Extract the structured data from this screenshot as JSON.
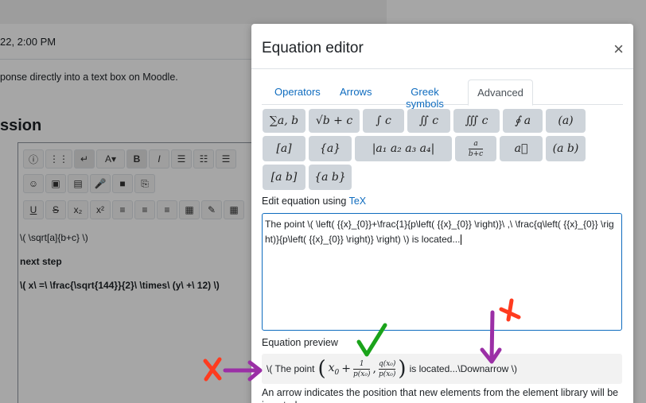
{
  "background": {
    "date": "22, 2:00 PM",
    "response_text": "ponse directly into a text box on Moodle.",
    "section_heading": "ssion",
    "editor_lines": [
      "\\( \\sqrt[a]{b+c} \\)",
      "next step",
      "\\( x\\ =\\ \\frac{\\sqrt{144}}{2}\\ \\times\\ (y\\ +\\ 12) \\)"
    ],
    "toolbar_row1": [
      "ⓘ",
      "⋮⋮",
      "↵",
      "A▾",
      "B",
      "I",
      "☰",
      "☷",
      "☰"
    ],
    "toolbar_row2": [
      "☺",
      "▣",
      "▤",
      "🎤",
      "■",
      "⎘"
    ],
    "toolbar_row3": [
      "U",
      "S",
      "x₂",
      "x²",
      "≡",
      "≡",
      "≡",
      "▦",
      "✎",
      "▦"
    ]
  },
  "modal": {
    "title": "Equation editor",
    "close_label": "×",
    "tabs": [
      {
        "label": "Operators",
        "active": false
      },
      {
        "label": "Arrows",
        "active": false
      },
      {
        "label": "Greek symbols",
        "active": false
      },
      {
        "label": "Advanced",
        "active": true
      }
    ],
    "library": {
      "row1": [
        "∑a, b",
        "√b + c",
        "∫ c",
        "∬ c",
        "∭ c",
        "∮ a",
        "(a)"
      ],
      "row2": [
        "[a]",
        "{a}",
        "|a₁   a₂ a₃   a₄|",
        "a / b+c",
        "a⃗",
        "(a b)"
      ],
      "row3": [
        "[a b]",
        "{a b}"
      ]
    },
    "edit_label": "Edit equation using",
    "edit_link": "TeX",
    "tex_value": "The point \\( \\left( {{x}_{0}}+\\frac{1}{p\\left( {{x}_{0}} \\right)}\\ ,\\ \\frac{q\\left( {{x}_{0}} \\right)}{p\\left( {{x}_{0}} \\right)} \\right) \\) is located...",
    "preview_label": "Equation preview",
    "preview": {
      "before": "\\( The point",
      "after": "is located...\\Downarrow \\)",
      "x0": "x",
      "x0_sub": "0",
      "frac1_num": "1",
      "frac1_den": "p(x₀)",
      "frac2_num": "q(x₀)",
      "frac2_den": "p(x₀)"
    },
    "note": "An arrow indicates the position that new elements from the element library will be inserted."
  },
  "annotation_colors": {
    "red": "#ff3b1f",
    "purple": "#9b2fa6",
    "green": "#1aa31a"
  }
}
